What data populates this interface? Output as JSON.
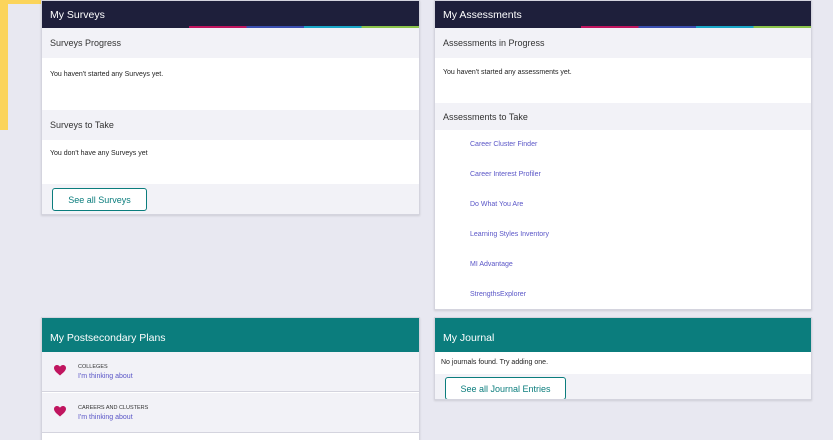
{
  "surveys": {
    "title": "My Surveys",
    "progress_heading": "Surveys Progress",
    "progress_text": "You haven't started any Surveys yet.",
    "to_take_heading": "Surveys to Take",
    "to_take_text": "You don't have any Surveys yet",
    "see_all_label": "See all Surveys"
  },
  "assessments": {
    "title": "My Assessments",
    "progress_heading": "Assessments in Progress",
    "progress_text": "You haven't started any assessments yet.",
    "to_take_heading": "Assessments to Take",
    "items": [
      "Career Cluster Finder",
      "Career Interest Profiler",
      "Do What You Are",
      "Learning Styles Inventory",
      "MI Advantage",
      "StrengthsExplorer"
    ]
  },
  "postsecondary": {
    "title": "My Postsecondary Plans",
    "rows": [
      {
        "category": "COLLEGES",
        "link": "I'm thinking about"
      },
      {
        "category": "CAREERS AND CLUSTERS",
        "link": "I'm thinking about"
      }
    ]
  },
  "journal": {
    "title": "My Journal",
    "empty_text": "No journals found. Try adding one.",
    "see_all_label": "See all Journal Entries"
  },
  "colors": {
    "header_dark": "#1e1f3b",
    "header_teal": "#0b7d7d",
    "link": "#5a56c7",
    "heart": "#c0155f"
  }
}
